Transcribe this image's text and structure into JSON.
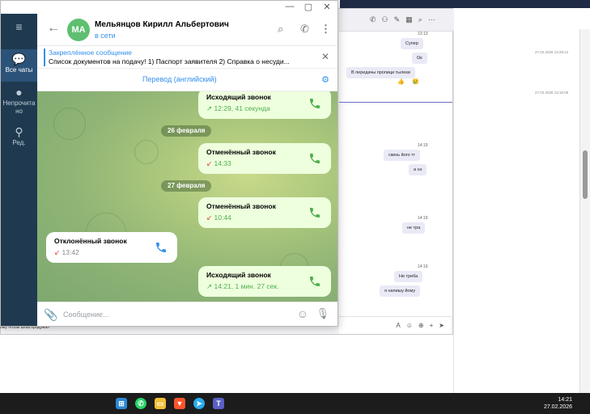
{
  "window": {
    "title": "Telegram",
    "controls": {
      "minimize": "—",
      "maximize": "▢",
      "close": "✕"
    }
  },
  "sidebar": {
    "items": [
      {
        "label": "Все чаты",
        "icon": "chats-icon",
        "active": true
      },
      {
        "label": "Непрочитано",
        "icon": "user-icon",
        "active": false
      },
      {
        "label": "Ред.",
        "icon": "edit-filters-icon",
        "active": false
      }
    ]
  },
  "chat": {
    "avatar_initials": "МА",
    "name": "Мельянцов Кирилл Альбертович",
    "status": "в сети",
    "avatar_color": "#5fbf71"
  },
  "pinned": {
    "title": "Закреплённое сообщение",
    "text": "Список документов на подачу!  1) Паспорт заявителя  2) Справка о несуди..."
  },
  "translate": {
    "label": "Перевод (английский)"
  },
  "messages": [
    {
      "type": "outgoing",
      "title": "Исходящий звонок",
      "meta": "12:29, 41 секунда",
      "arrow": "↗"
    },
    {
      "type": "date",
      "text": "26 февраля"
    },
    {
      "type": "outgoing",
      "title": "Отменённый звонок",
      "meta": "14:33",
      "arrow": "↙"
    },
    {
      "type": "date",
      "text": "27 февраля"
    },
    {
      "type": "outgoing",
      "title": "Отменённый звонок",
      "meta": "10:44",
      "arrow": "↙"
    },
    {
      "type": "incoming",
      "title": "Отклонённый звонок",
      "meta": "13:42",
      "arrow": "↙"
    },
    {
      "type": "outgoing",
      "title": "Исходящий звонок",
      "meta": "14:21, 1 мин. 27 сек.",
      "arrow": "↗"
    }
  ],
  "composer": {
    "placeholder": "Сообщение..."
  },
  "background_app": {
    "times": [
      "13:13",
      "14:19",
      "14:19",
      "14:19"
    ],
    "messages": [
      "Супер",
      "Ок",
      "В передачы пропици тылеки",
      "скинь його тг",
      "а нэ",
      "не тра",
      "Не треба",
      "я напишу йому"
    ],
    "reactions": [
      "👍",
      "😢"
    ],
    "timestamps_far": [
      "27.02.2026 13:28:12",
      "27.02.2026 13:10:06"
    ],
    "under_text": "ому чтобы Шош продумал"
  },
  "taskbar": {
    "time": "14:21",
    "date": "27.02.2026",
    "apps": [
      "windows-start-icon",
      "whatsapp-icon",
      "file-explorer-icon",
      "brave-icon",
      "telegram-icon",
      "teams-icon"
    ]
  }
}
